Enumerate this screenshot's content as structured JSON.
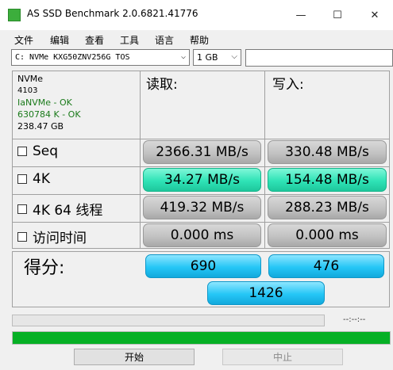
{
  "window": {
    "title": "AS SSD Benchmark 2.0.6821.41776",
    "controls": [
      "—",
      "☐",
      "✕"
    ]
  },
  "menu": [
    "文件",
    "编辑",
    "查看",
    "工具",
    "语言",
    "帮助"
  ],
  "toolbar": {
    "drive": "C: NVMe KXG50ZNV256G TOS",
    "size": "1 GB",
    "text_value": ""
  },
  "drive_info": {
    "model": "NVMe",
    "firmware": "4103",
    "driver": "IaNVMe - OK",
    "alignment": "630784 K - OK",
    "capacity": "238.47 GB"
  },
  "columns": {
    "read": "读取:",
    "write": "写入:"
  },
  "tests": [
    {
      "label": "Seq",
      "read": "2366.31 MB/s",
      "write": "330.48 MB/s"
    },
    {
      "label": "4K",
      "read": "34.27 MB/s",
      "write": "154.48 MB/s"
    },
    {
      "label": "4K 64 线程",
      "read": "419.32 MB/s",
      "write": "288.23 MB/s"
    },
    {
      "label": "访问时间",
      "read": "0.000 ms",
      "write": "0.000 ms"
    }
  ],
  "score": {
    "label": "得分:",
    "read": "690",
    "write": "476",
    "total": "1426"
  },
  "progress": {
    "time": "--:--:--",
    "small_fraction": 0.0,
    "main_fraction": 1.0
  },
  "buttons": {
    "start": "开始",
    "stop": "中止"
  },
  "colors": {
    "ok_text": "#1a7a1a",
    "progress_fill": "#06b025",
    "highlight_result": "#2fe3b6",
    "score": "#25c6f6"
  }
}
